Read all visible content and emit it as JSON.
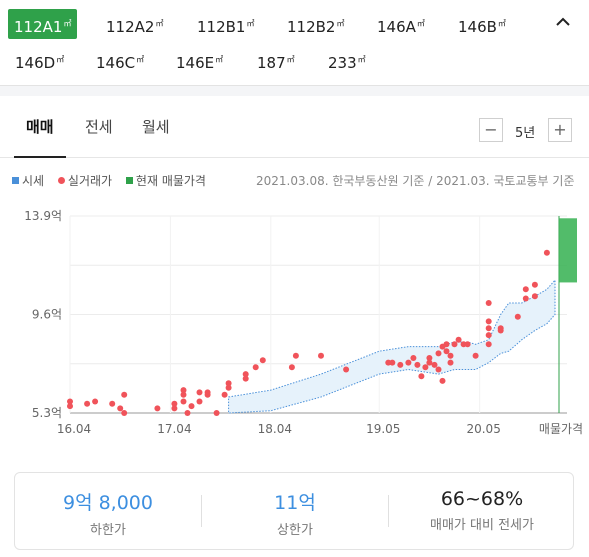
{
  "area_types": [
    {
      "label": "112A1",
      "unit": "㎡",
      "active": true
    },
    {
      "label": "112A2",
      "unit": "㎡",
      "active": false
    },
    {
      "label": "112B1",
      "unit": "㎡",
      "active": false
    },
    {
      "label": "112B2",
      "unit": "㎡",
      "active": false
    },
    {
      "label": "146A",
      "unit": "㎡",
      "active": false
    },
    {
      "label": "146B",
      "unit": "㎡",
      "active": false
    },
    {
      "label": "146D",
      "unit": "㎡",
      "active": false
    },
    {
      "label": "146C",
      "unit": "㎡",
      "active": false
    },
    {
      "label": "146E",
      "unit": "㎡",
      "active": false
    },
    {
      "label": "187",
      "unit": "㎡",
      "active": false
    },
    {
      "label": "233",
      "unit": "㎡",
      "active": false
    }
  ],
  "tabs": [
    "매매",
    "전세",
    "월세"
  ],
  "active_tab": "매매",
  "period": {
    "label": "5년",
    "minus": "−",
    "plus": "+"
  },
  "legend": [
    {
      "label": "시세",
      "color": "#4a90d9"
    },
    {
      "label": "실거래가",
      "color": "#f0535a"
    },
    {
      "label": "현재 매물가격",
      "color": "#2fa14a"
    }
  ],
  "source_note": "2021.03.08. 한국부동산원 기준 / 2021.03. 국토교통부 기준",
  "colors": {
    "accent_green": "#2fa14a",
    "trade_red": "#f0535a",
    "market_blue": "#4a90d9",
    "value_blue": "#3d8fe0"
  },
  "chart_data": {
    "type": "scatter",
    "y_ticks": [
      {
        "label": "13.9억",
        "value": 13.9
      },
      {
        "label": "9.6억",
        "value": 9.6
      },
      {
        "label": "5.3억",
        "value": 5.3
      }
    ],
    "ylim": [
      5.3,
      13.9
    ],
    "x_ticks": [
      {
        "label": "16.04",
        "value": 2016.25
      },
      {
        "label": "17.04",
        "value": 2017.25
      },
      {
        "label": "18.04",
        "value": 2018.25
      },
      {
        "label": "19.05",
        "value": 2019.33
      },
      {
        "label": "20.05",
        "value": 2020.33
      },
      {
        "label": "매물가격",
        "value": 2021.2
      }
    ],
    "xlim": [
      2016.25,
      2021.2
    ],
    "grid": true,
    "transactions": [
      [
        2016.25,
        5.8
      ],
      [
        2016.25,
        5.6
      ],
      [
        2016.42,
        5.7
      ],
      [
        2016.5,
        5.8
      ],
      [
        2016.67,
        5.7
      ],
      [
        2016.75,
        5.5
      ],
      [
        2016.79,
        6.1
      ],
      [
        2016.79,
        5.3
      ],
      [
        2017.12,
        5.5
      ],
      [
        2017.29,
        5.7
      ],
      [
        2017.29,
        5.5
      ],
      [
        2017.38,
        6.1
      ],
      [
        2017.38,
        6.3
      ],
      [
        2017.38,
        5.8
      ],
      [
        2017.42,
        5.3
      ],
      [
        2017.46,
        5.6
      ],
      [
        2017.54,
        6.2
      ],
      [
        2017.54,
        5.8
      ],
      [
        2017.62,
        6.2
      ],
      [
        2017.62,
        6.1
      ],
      [
        2017.71,
        5.3
      ],
      [
        2017.79,
        6.1
      ],
      [
        2017.83,
        6.4
      ],
      [
        2017.83,
        6.6
      ],
      [
        2018.0,
        6.8
      ],
      [
        2018.0,
        7.0
      ],
      [
        2018.1,
        7.3
      ],
      [
        2018.17,
        7.6
      ],
      [
        2018.46,
        7.3
      ],
      [
        2018.5,
        7.8
      ],
      [
        2018.75,
        7.8
      ],
      [
        2019.0,
        7.2
      ],
      [
        2019.42,
        7.5
      ],
      [
        2019.46,
        7.5
      ],
      [
        2019.54,
        7.4
      ],
      [
        2019.62,
        7.5
      ],
      [
        2019.67,
        7.7
      ],
      [
        2019.71,
        7.4
      ],
      [
        2019.75,
        6.9
      ],
      [
        2019.79,
        7.3
      ],
      [
        2019.83,
        7.5
      ],
      [
        2019.83,
        7.7
      ],
      [
        2019.88,
        7.4
      ],
      [
        2019.92,
        7.2
      ],
      [
        2019.92,
        7.9
      ],
      [
        2019.96,
        8.2
      ],
      [
        2019.96,
        6.7
      ],
      [
        2020.0,
        8.3
      ],
      [
        2020.0,
        8.0
      ],
      [
        2020.04,
        7.8
      ],
      [
        2020.04,
        7.5
      ],
      [
        2020.08,
        8.3
      ],
      [
        2020.12,
        8.5
      ],
      [
        2020.17,
        8.3
      ],
      [
        2020.21,
        8.3
      ],
      [
        2020.29,
        7.8
      ],
      [
        2020.42,
        8.3
      ],
      [
        2020.42,
        8.7
      ],
      [
        2020.42,
        9.0
      ],
      [
        2020.42,
        9.3
      ],
      [
        2020.42,
        10.1
      ],
      [
        2020.54,
        8.9
      ],
      [
        2020.54,
        9.0
      ],
      [
        2020.71,
        9.5
      ],
      [
        2020.79,
        10.3
      ],
      [
        2020.79,
        10.7
      ],
      [
        2020.88,
        10.4
      ],
      [
        2020.88,
        10.9
      ],
      [
        2021.0,
        12.3
      ]
    ],
    "market_band": {
      "x": [
        2017.83,
        2018.25,
        2018.75,
        2019.33,
        2019.62,
        2019.92,
        2020.08,
        2020.21,
        2020.29,
        2020.42,
        2020.54,
        2020.62,
        2020.75,
        2020.88,
        2021.0,
        2021.08
      ],
      "upper": [
        6.0,
        6.3,
        7.0,
        8.0,
        8.2,
        8.2,
        8.4,
        8.4,
        8.3,
        8.5,
        9.6,
        10.1,
        10.1,
        10.4,
        10.7,
        11.1
      ],
      "lower": [
        5.3,
        5.4,
        6.0,
        7.0,
        7.2,
        7.0,
        7.2,
        7.2,
        7.2,
        7.5,
        7.9,
        8.0,
        8.5,
        8.9,
        9.2,
        9.6
      ]
    },
    "current_listing": {
      "x": 2021.2,
      "low": 11.0,
      "high": 13.8
    }
  },
  "summary": {
    "low_value": "9억 8,000",
    "low_label": "하한가",
    "high_value": "11억",
    "high_label": "상한가",
    "ratio_value": "66~68%",
    "ratio_label": "매매가 대비 전세가"
  }
}
